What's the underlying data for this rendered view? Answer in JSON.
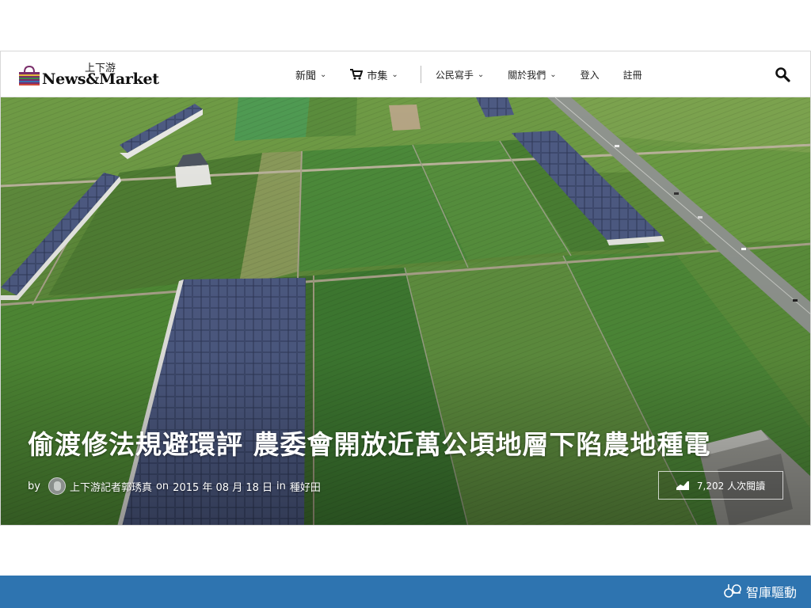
{
  "logo": {
    "small_text": "上下游",
    "brand_text": "News&Market"
  },
  "nav": {
    "items": [
      {
        "label": "新聞",
        "has_dropdown": true
      },
      {
        "label": "市集",
        "has_dropdown": true,
        "icon": "cart-icon"
      },
      {
        "label": "公民寫手",
        "has_dropdown": true
      },
      {
        "label": "關於我們",
        "has_dropdown": true
      },
      {
        "label": "登入",
        "has_dropdown": false
      },
      {
        "label": "註冊",
        "has_dropdown": false
      }
    ],
    "search_icon": "search-icon"
  },
  "article": {
    "title": "偷渡修法規避環評 農委會開放近萬公頃地層下陷農地種電",
    "byline": {
      "by": "by",
      "author": "上下游記者郭琇真",
      "on": "on",
      "date": "2015 年 08 月 18 日",
      "in": "in",
      "category": "種好田"
    },
    "views": "7,202 人次閱讀"
  },
  "footer": {
    "brand": "智庫驅動",
    "color": "#2e74b0"
  },
  "colors": {
    "footer_bar": "#2e74b0",
    "headline": "#ffffff"
  }
}
